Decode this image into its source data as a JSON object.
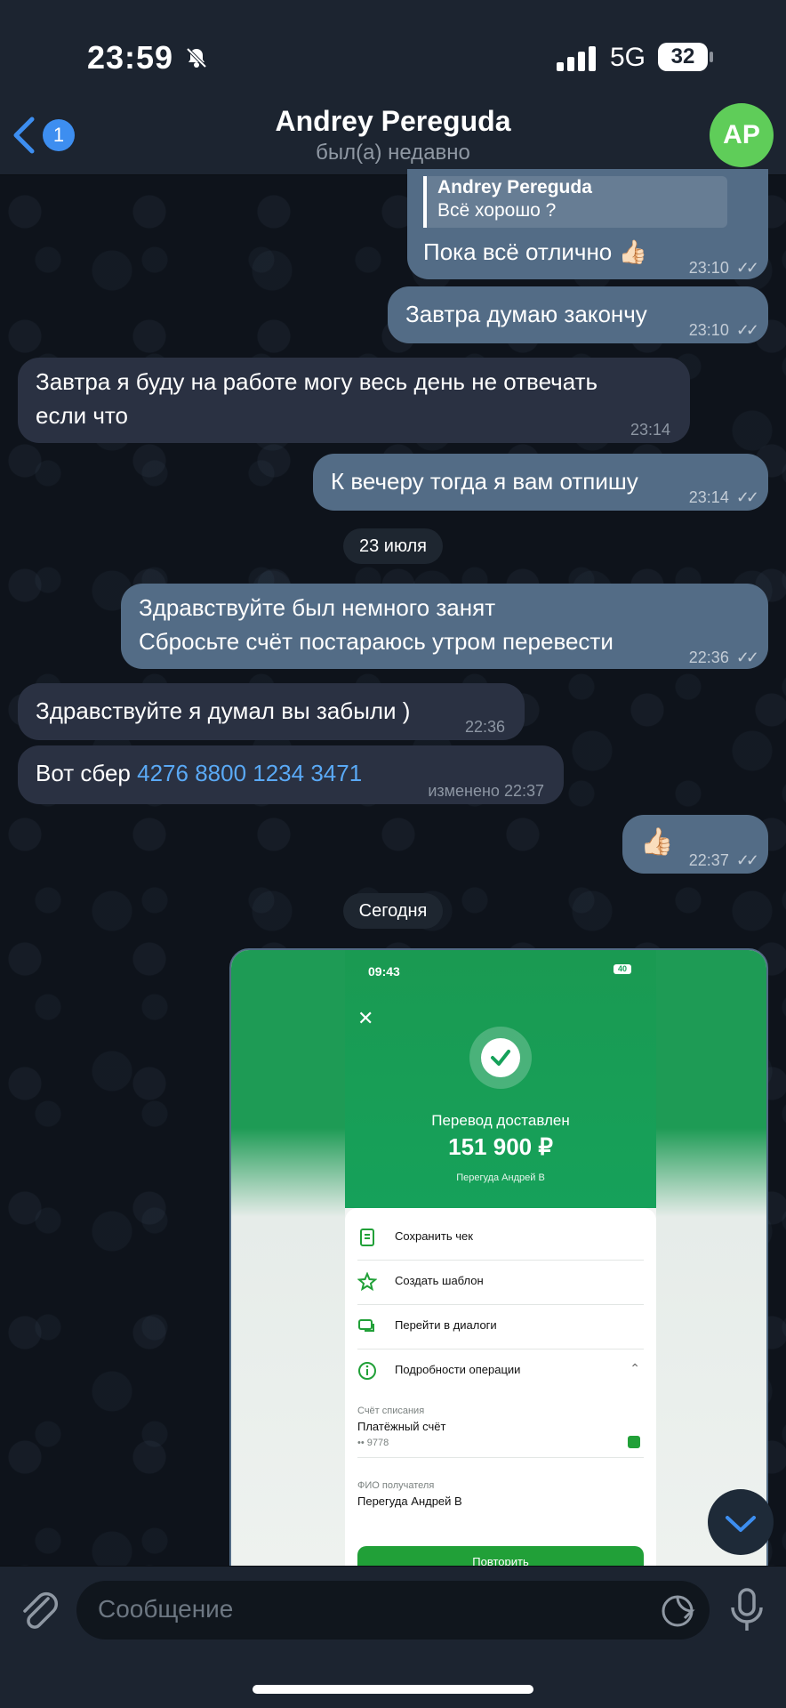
{
  "status_bar": {
    "time": "23:59",
    "network": "5G",
    "battery": "32"
  },
  "header": {
    "back_count": "1",
    "title": "Andrey Pereguda",
    "subtitle": "был(а) недавно",
    "avatar_initials": "AP"
  },
  "messages": [
    {
      "dir": "out",
      "reply_to_name": "Andrey Pereguda",
      "reply_to_text": "Всё хорошо ?",
      "text": "Пока всё отлично 👍🏻",
      "time": "23:10"
    },
    {
      "dir": "out",
      "text": "Завтра думаю закончу",
      "time": "23:10"
    },
    {
      "dir": "in",
      "line1": "Завтра я буду на работе могу весь день не отвечать",
      "line2": "если что",
      "time": "23:14"
    },
    {
      "dir": "out",
      "text": "К вечеру тогда я вам отпишу",
      "time": "23:14"
    },
    {
      "dir": "out",
      "line1": "Здравствуйте был немного занят",
      "line2": "Сбросьте счёт постараюсь утром перевести",
      "time": "22:36"
    },
    {
      "dir": "in",
      "text": "Здравствуйте я думал вы забыли )",
      "time": "22:36"
    },
    {
      "dir": "in",
      "prefix": "Вот сбер",
      "link": "4276 8800 1234 3471",
      "edited_label": "изменено",
      "time": "22:37"
    },
    {
      "dir": "out",
      "text": "👍🏻",
      "time": "22:37"
    }
  ],
  "date_separators": {
    "first": "23 июля",
    "second": "Сегодня"
  },
  "photo": {
    "time": "09:43",
    "battery": "40",
    "title": "Перевод доставлен",
    "amount": "151 900 ₽",
    "recipient": "Перегуда Андрей В",
    "actions": [
      "Сохранить чек",
      "Создать шаблон",
      "Перейти в диалоги",
      "Подробности операции"
    ],
    "account_label": "Счёт списания",
    "account_name": "Платёжный счёт",
    "account_number": "•• 9778",
    "fio_label": "ФИО получателя",
    "fio_value": "Перегуда Андрей В",
    "repeat_button": "Повторить"
  },
  "input": {
    "placeholder": "Сообщение"
  },
  "colors": {
    "accent": "#3d8ef0",
    "outgoing": "#536c86",
    "incoming": "#2a3142",
    "avatar": "#5fcd59",
    "sber_green": "#21a038"
  }
}
